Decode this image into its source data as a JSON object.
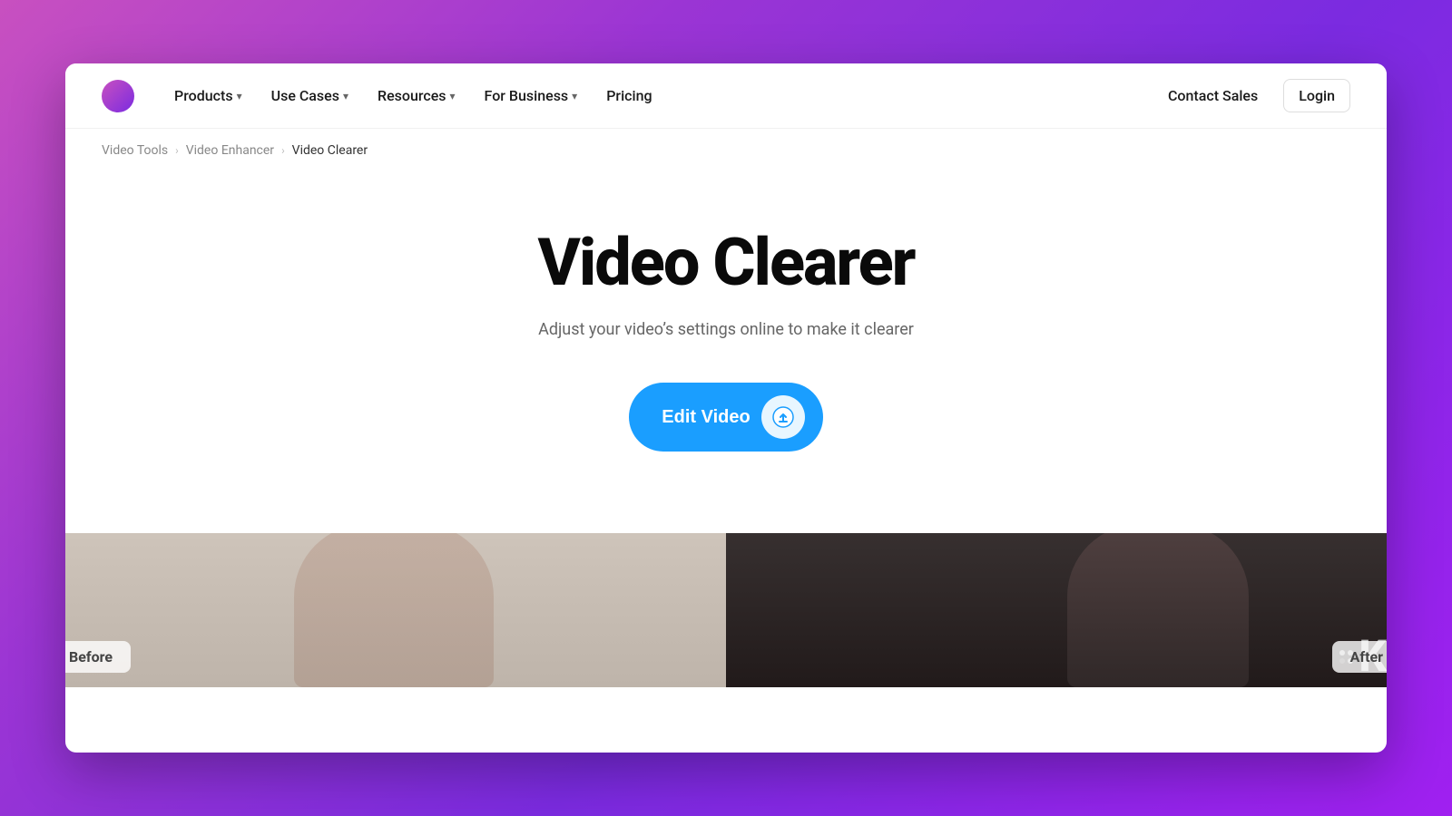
{
  "background": {
    "gradient": "linear-gradient(135deg, #c850c0 0%, #9b35d4 30%, #7b2be0 60%, #a020f0 100%)"
  },
  "navbar": {
    "logo_alt": "Kapwing logo",
    "nav_items": [
      {
        "label": "Products",
        "has_dropdown": true
      },
      {
        "label": "Use Cases",
        "has_dropdown": true
      },
      {
        "label": "Resources",
        "has_dropdown": true
      },
      {
        "label": "For Business",
        "has_dropdown": true
      },
      {
        "label": "Pricing",
        "has_dropdown": false
      }
    ],
    "contact_sales_label": "Contact Sales",
    "login_label": "Login"
  },
  "breadcrumb": {
    "items": [
      {
        "label": "Video Tools",
        "active": false
      },
      {
        "label": "Video Enhancer",
        "active": false
      },
      {
        "label": "Video Clearer",
        "active": true
      }
    ]
  },
  "hero": {
    "title": "Video Clearer",
    "subtitle": "Adjust your video’s settings online to make it clearer",
    "cta_label": "Edit Video",
    "upload_icon": "upload-icon"
  },
  "before_after": {
    "before_label": "Before",
    "after_label": "After"
  },
  "watermark": {
    "letter": "K"
  }
}
